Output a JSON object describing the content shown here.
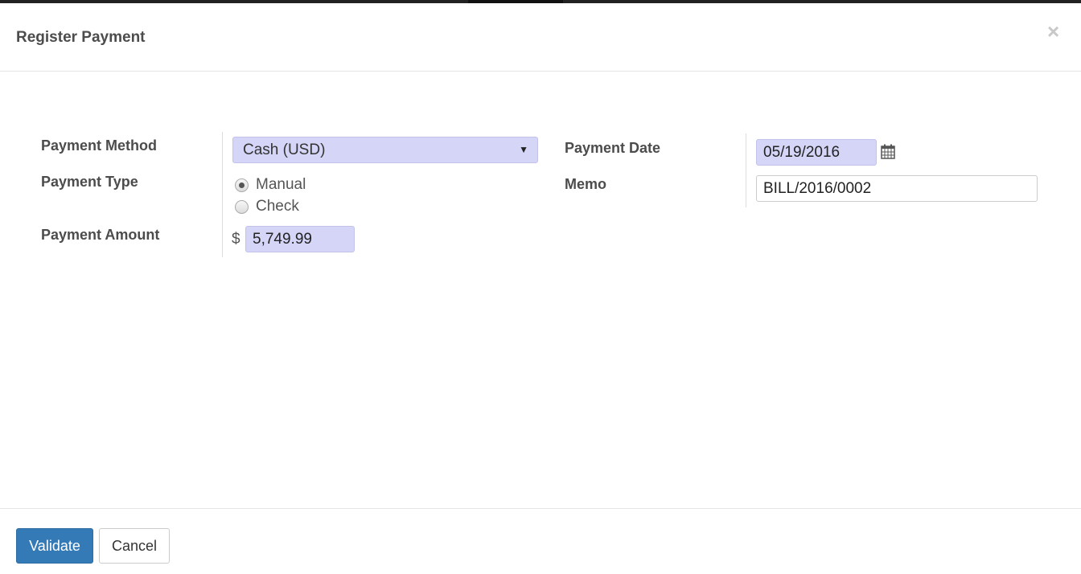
{
  "dialog": {
    "title": "Register Payment",
    "close_symbol": "×"
  },
  "form": {
    "payment_method": {
      "label": "Payment Method",
      "value": "Cash (USD)",
      "arrow": "▼"
    },
    "payment_type": {
      "label": "Payment Type",
      "options": [
        {
          "label": "Manual",
          "checked": true
        },
        {
          "label": "Check",
          "checked": false
        }
      ]
    },
    "payment_amount": {
      "label": "Payment Amount",
      "currency": "$",
      "value": "5,749.99"
    },
    "payment_date": {
      "label": "Payment Date",
      "value": "05/19/2016",
      "icon": "calendar-icon"
    },
    "memo": {
      "label": "Memo",
      "value": "BILL/2016/0002"
    }
  },
  "footer": {
    "validate_label": "Validate",
    "cancel_label": "Cancel"
  },
  "colors": {
    "primary": "#337ab7",
    "required_field": "#d5d5f8"
  }
}
